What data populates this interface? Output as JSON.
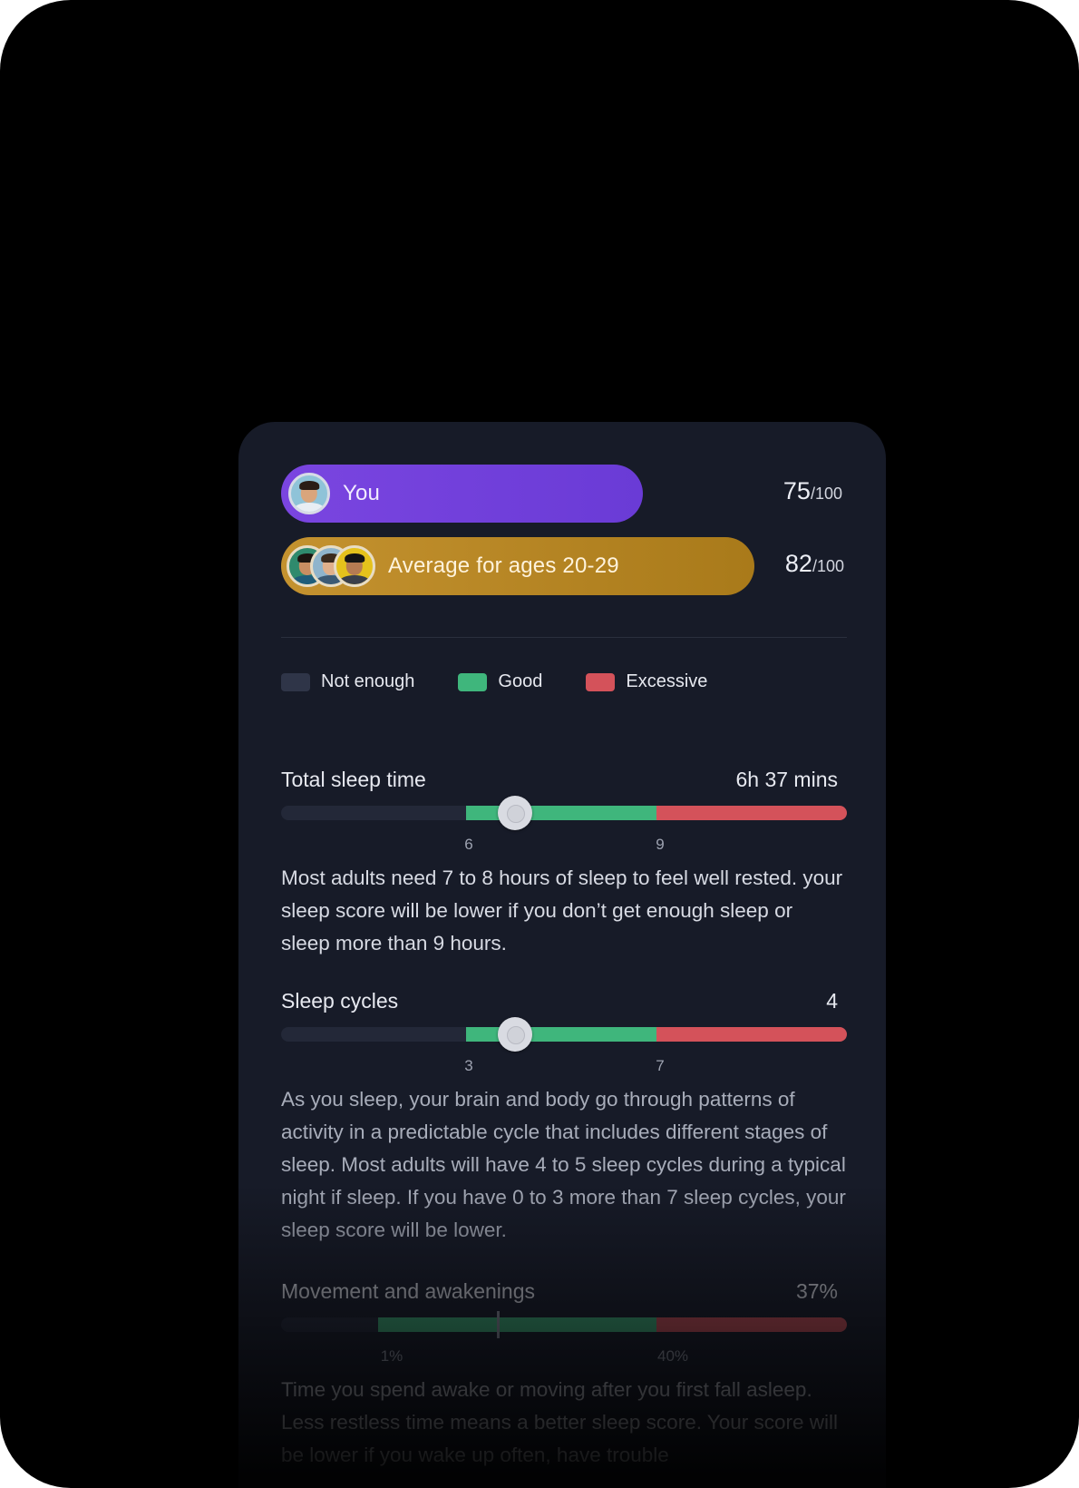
{
  "comparison": {
    "you": {
      "label": "You",
      "score": "75",
      "max": "/100",
      "avatar": "user-avatar"
    },
    "average": {
      "label": "Average for ages 20-29",
      "score": "82",
      "max": "/100",
      "avatars": [
        "peer-avatar-1",
        "peer-avatar-2",
        "peer-avatar-3"
      ]
    }
  },
  "legend": [
    {
      "label": "Not enough",
      "color": "#2f3548"
    },
    {
      "label": "Good",
      "color": "#3fb67c"
    },
    {
      "label": "Excessive",
      "color": "#d4525a"
    }
  ],
  "metrics": [
    {
      "title": "Total sleep time",
      "value": "6h 37 mins",
      "range": [
        0,
        12
      ],
      "good_range": [
        6,
        9
      ],
      "current": 6.617,
      "ticks": [
        "6",
        "9"
      ],
      "description": "Most adults need 7 to 8 hours of sleep to feel well rested. your sleep score will be lower if you don’t get enough sleep or sleep more than 9 hours."
    },
    {
      "title": "Sleep cycles",
      "value": "4",
      "range": [
        0,
        12
      ],
      "good_range": [
        3,
        7
      ],
      "current": 4,
      "ticks": [
        "3",
        "7"
      ],
      "description": "As you sleep, your brain and body go through patterns of activity in a predictable cycle that includes different stages of sleep. Most adults will have 4 to 5 sleep cycles during a typical night if sleep. If you have 0 to 3 more than 7 sleep cycles, your sleep score will be lower."
    },
    {
      "title": "Movement and awakenings",
      "value": "37%",
      "good_range": [
        "1%",
        "40%"
      ],
      "current": "37%",
      "ticks": [
        "1%",
        "40%"
      ],
      "description": "Time you spend awake or moving after you first fall asleep. Less restless time means a better sleep score. Your score will be lower if you wake up often, have trouble"
    }
  ]
}
